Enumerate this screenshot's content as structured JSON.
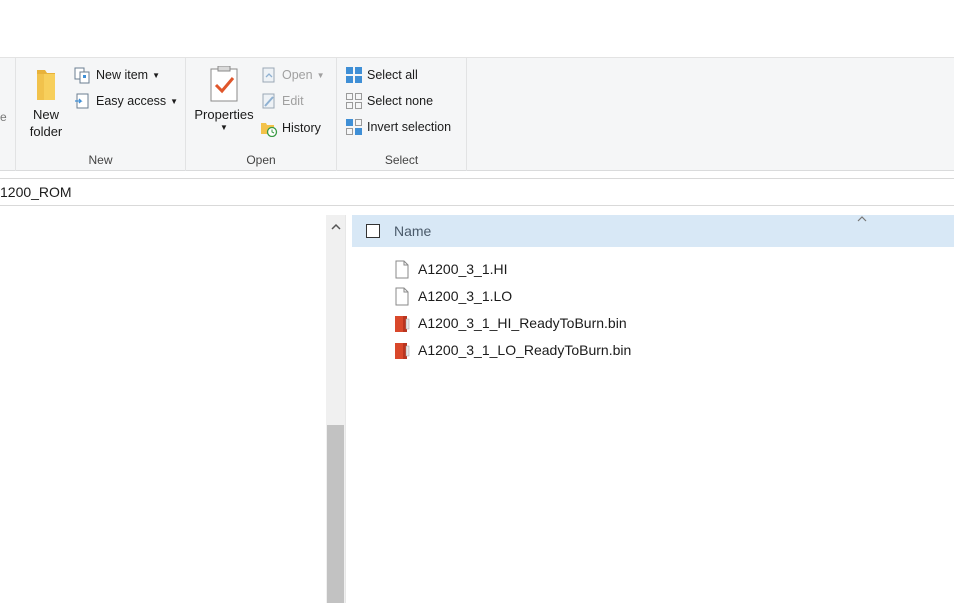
{
  "ribbon": {
    "cut_char": "e",
    "new_group": {
      "label": "New",
      "new_folder_line1": "New",
      "new_folder_line2": "folder",
      "new_item": "New item",
      "easy_access": "Easy access"
    },
    "open_group": {
      "label": "Open",
      "properties": "Properties",
      "open": "Open",
      "edit": "Edit",
      "history": "History"
    },
    "select_group": {
      "label": "Select",
      "select_all": "Select all",
      "select_none": "Select none",
      "invert_selection": "Invert selection"
    }
  },
  "address": {
    "path": "1200_ROM"
  },
  "file_list": {
    "header": {
      "name": "Name",
      "sort": "ascending"
    },
    "files": [
      {
        "name": "A1200_3_1.HI",
        "icon": "generic-file-icon"
      },
      {
        "name": "A1200_3_1.LO",
        "icon": "generic-file-icon"
      },
      {
        "name": "A1200_3_1_HI_ReadyToBurn.bin",
        "icon": "bin-file-icon"
      },
      {
        "name": "A1200_3_1_LO_ReadyToBurn.bin",
        "icon": "bin-file-icon"
      }
    ]
  },
  "colors": {
    "ribbon_bg": "#f5f6f7",
    "header_bg": "#d8e8f6",
    "folder": "#f3c24a",
    "accent_blue": "#3f8fd6",
    "bin_red": "#d9482b"
  }
}
